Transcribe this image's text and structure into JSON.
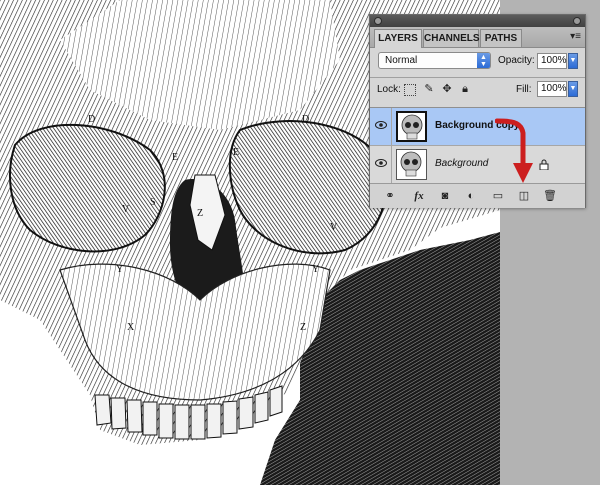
{
  "layers_panel": {
    "tabs": [
      {
        "label": "LAYERS",
        "active": true
      },
      {
        "label": "CHANNELS",
        "active": false
      },
      {
        "label": "PATHS",
        "active": false
      }
    ],
    "blend_mode": "Normal",
    "opacity_label": "Opacity:",
    "opacity_value": "100%",
    "lock_label": "Lock:",
    "fill_label": "Fill:",
    "fill_value": "100%",
    "layers": [
      {
        "name": "Background copy",
        "selected": true,
        "visible": true,
        "locked": false
      },
      {
        "name": "Background",
        "selected": false,
        "visible": true,
        "locked": true
      }
    ],
    "footer_icons": [
      "link-layers-icon",
      "fx-icon",
      "add-mask-icon",
      "adjustment-layer-icon",
      "new-group-icon",
      "new-layer-icon",
      "trash-icon"
    ],
    "fx_label": "fx",
    "highlight_color": "#a9c8f5",
    "accent_color": "#2c6bd6"
  },
  "canvas": {
    "engraving_labels": [
      "D",
      "D",
      "E",
      "E",
      "V",
      "V",
      "Y",
      "Y",
      "X",
      "Z",
      "Z",
      "S"
    ]
  },
  "annotation": {
    "arrow_color": "#cc1f1f",
    "arrow_target": "new-layer-icon"
  }
}
